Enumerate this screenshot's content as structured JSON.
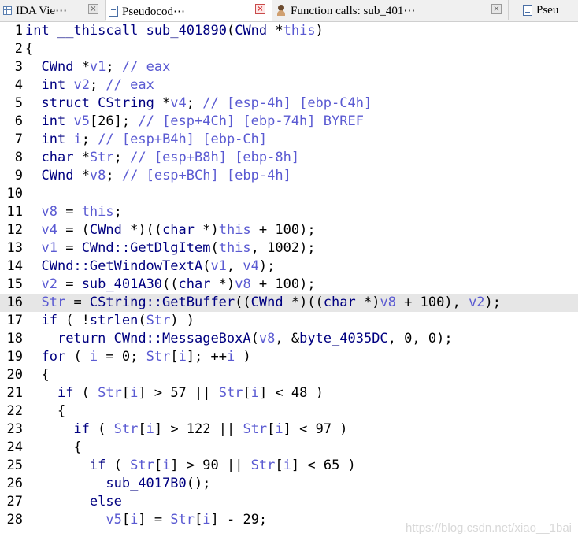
{
  "tabs": [
    {
      "label": "IDA Vie⋯",
      "icon": "grid-icon",
      "active": false
    },
    {
      "label": "Pseudocod⋯",
      "icon": "document-icon",
      "active": true
    },
    {
      "label": "Function calls: sub_401⋯",
      "icon": "function-calls-icon",
      "active": false
    },
    {
      "label": "Pseu",
      "icon": "document-icon",
      "active": false
    }
  ],
  "close_glyph": "×",
  "code": {
    "current_line": 16,
    "lines": [
      {
        "n": "1",
        "t": "int __thiscall sub_401890(CWnd *this)"
      },
      {
        "n": "2",
        "t": "{"
      },
      {
        "n": "3",
        "t": "  CWnd *v1; // eax"
      },
      {
        "n": "4",
        "t": "  int v2; // eax"
      },
      {
        "n": "5",
        "t": "  struct CString *v4; // [esp-4h] [ebp-C4h]"
      },
      {
        "n": "6",
        "t": "  int v5[26]; // [esp+4Ch] [ebp-74h] BYREF"
      },
      {
        "n": "7",
        "t": "  int i; // [esp+B4h] [ebp-Ch]"
      },
      {
        "n": "8",
        "t": "  char *Str; // [esp+B8h] [ebp-8h]"
      },
      {
        "n": "9",
        "t": "  CWnd *v8; // [esp+BCh] [ebp-4h]"
      },
      {
        "n": "10",
        "t": ""
      },
      {
        "n": "11",
        "t": "  v8 = this;"
      },
      {
        "n": "12",
        "t": "  v4 = (CWnd *)((char *)this + 100);"
      },
      {
        "n": "13",
        "t": "  v1 = CWnd::GetDlgItem(this, 1002);"
      },
      {
        "n": "14",
        "t": "  CWnd::GetWindowTextA(v1, v4);"
      },
      {
        "n": "15",
        "t": "  v2 = sub_401A30((char *)v8 + 100);"
      },
      {
        "n": "16",
        "t": "  Str = CString::GetBuffer((CWnd *)((char *)v8 + 100), v2);"
      },
      {
        "n": "17",
        "t": "  if ( !strlen(Str) )"
      },
      {
        "n": "18",
        "t": "    return CWnd::MessageBoxA(v8, &byte_4035DC, 0, 0);"
      },
      {
        "n": "19",
        "t": "  for ( i = 0; Str[i]; ++i )"
      },
      {
        "n": "20",
        "t": "  {"
      },
      {
        "n": "21",
        "t": "    if ( Str[i] > 57 || Str[i] < 48 )"
      },
      {
        "n": "22",
        "t": "    {"
      },
      {
        "n": "23",
        "t": "      if ( Str[i] > 122 || Str[i] < 97 )"
      },
      {
        "n": "24",
        "t": "      {"
      },
      {
        "n": "25",
        "t": "        if ( Str[i] > 90 || Str[i] < 65 )"
      },
      {
        "n": "26",
        "t": "          sub_4017B0();"
      },
      {
        "n": "27",
        "t": "        else"
      },
      {
        "n": "28",
        "t": "          v5[i] = Str[i] - 29;"
      }
    ]
  },
  "watermark": "https://blog.csdn.net/xiao__1bai",
  "colors": {
    "keyword": "#000080",
    "comment": "#5a5ad2",
    "highlight": "#e6e6e6"
  }
}
